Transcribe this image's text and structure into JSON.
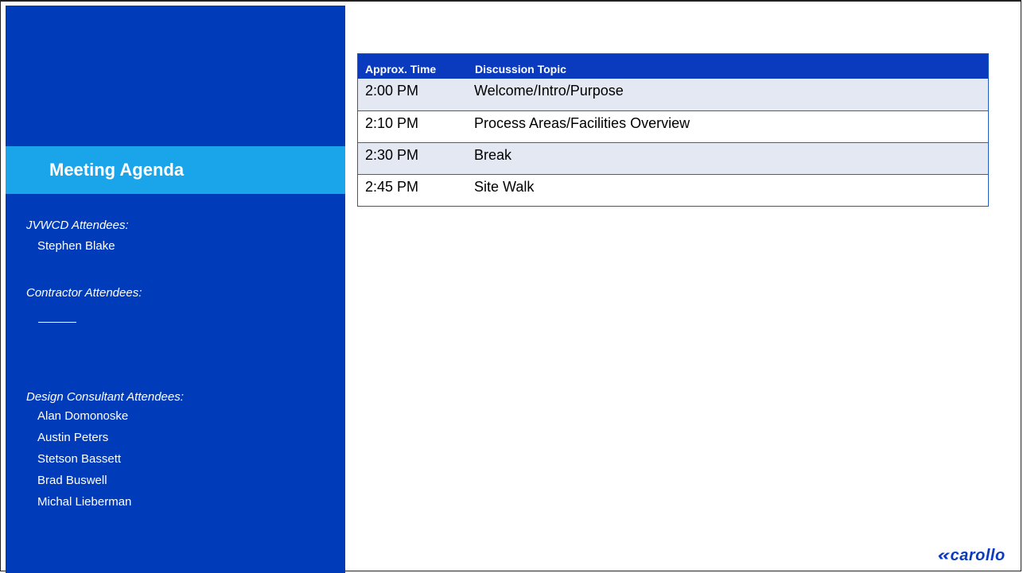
{
  "sidebar": {
    "title": "Meeting Agenda",
    "jvwcd_label": "JVWCD Attendees:",
    "jvwcd_names": [
      "Stephen Blake"
    ],
    "contractor_label": "Contractor Attendees:",
    "consultant_label": "Design Consultant Attendees:",
    "consultant_names": [
      "Alan Domonoske",
      "Austin Peters",
      "Stetson Bassett",
      "Brad Buswell",
      "Michal Lieberman"
    ]
  },
  "agenda": {
    "headers": [
      "Approx. Time",
      "Discussion Topic"
    ],
    "rows": [
      {
        "time": "2:00 PM",
        "topic": "Welcome/Intro/Purpose"
      },
      {
        "time": "2:10 PM",
        "topic": "Process Areas/Facilities Overview"
      },
      {
        "time": "2:30 PM",
        "topic": "Break"
      },
      {
        "time": "2:45 PM",
        "topic": "Site Walk"
      }
    ]
  },
  "logo": {
    "text": "carollo"
  },
  "colors": {
    "sidebar": "#003BBA",
    "banner": "#1AA5EA",
    "table_header": "#0A3BBF",
    "row_shade": "#E3E8F2"
  }
}
